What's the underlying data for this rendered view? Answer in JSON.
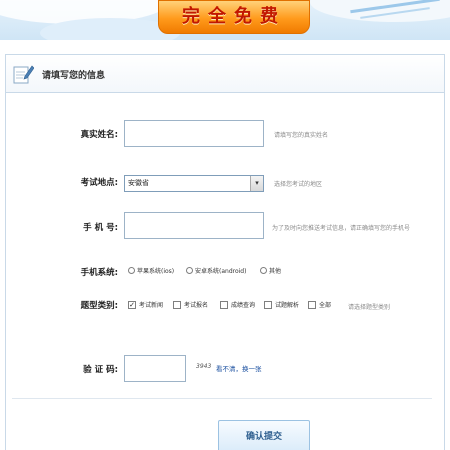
{
  "banner": {
    "free_text": "完全免费"
  },
  "panel": {
    "title": "请填写您的信息"
  },
  "form": {
    "name": {
      "label": "真实姓名:",
      "value": "",
      "hint": "请填写您的真实姓名"
    },
    "location": {
      "label": "考试地点:",
      "selected": "安徽省",
      "hint": "选择您考试的地区"
    },
    "phone": {
      "label": "手 机 号:",
      "value": "",
      "hint": "为了及时向您推送考试信息，请正确填写您的手机号"
    },
    "os": {
      "label": "手机系统:",
      "options": [
        "苹果系统(ios)",
        "安卓系统(android)",
        "其他"
      ]
    },
    "question_type": {
      "label": "题型类别:",
      "options": [
        {
          "label": "考试新闻",
          "checked": true
        },
        {
          "label": "考试报名",
          "checked": false
        },
        {
          "label": "成绩查询",
          "checked": false
        },
        {
          "label": "试题解析",
          "checked": false
        },
        {
          "label": "全部",
          "checked": false
        }
      ],
      "hint": "请选择题型类别"
    },
    "captcha": {
      "label": "验 证 码:",
      "value": "",
      "image_text": "3943",
      "refresh": "看不清，换一张"
    }
  },
  "submit_label": "确认提交"
}
